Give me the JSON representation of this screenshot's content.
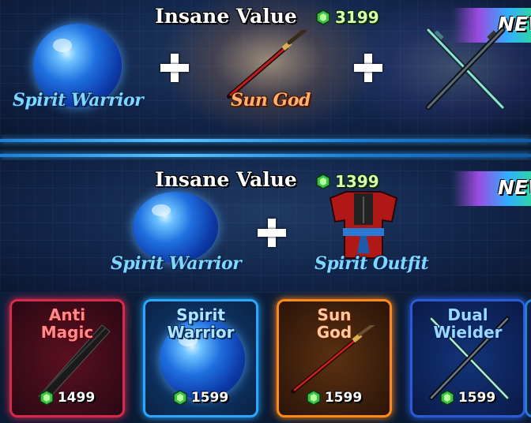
{
  "bundles": [
    {
      "title": "Insane Value",
      "price": "3199",
      "badge": "NEW",
      "items": [
        {
          "label": "Spirit Warrior",
          "icon": "spirit-orb"
        },
        {
          "label": "Sun God",
          "icon": "red-katana"
        },
        {
          "label": "",
          "icon": "crossed-swords"
        }
      ]
    },
    {
      "title": "Insane Value",
      "price": "1399",
      "badge": "NEW",
      "items": [
        {
          "label": "Spirit Warrior",
          "icon": "spirit-orb"
        },
        {
          "label": "Spirit Outfit",
          "icon": "red-outfit"
        }
      ]
    }
  ],
  "cards": [
    {
      "title_line1": "Anti",
      "title_line2": "Magic",
      "price": "1499",
      "icon": "black-greatsword",
      "color": "#d62a4a"
    },
    {
      "title_line1": "Spirit",
      "title_line2": "Warrior",
      "price": "1599",
      "icon": "spirit-orb",
      "color": "#2aa8ff"
    },
    {
      "title_line1": "Sun",
      "title_line2": "God",
      "price": "1599",
      "icon": "red-katana",
      "color": "#ff8a1a"
    },
    {
      "title_line1": "Dual",
      "title_line2": "Wielder",
      "price": "1599",
      "icon": "crossed-swords",
      "color": "#2a5ad6"
    }
  ],
  "currency_icon": "gem-icon",
  "colors": {
    "price_green": "#d8ffb0",
    "divider_blue": "#39a9ff"
  }
}
